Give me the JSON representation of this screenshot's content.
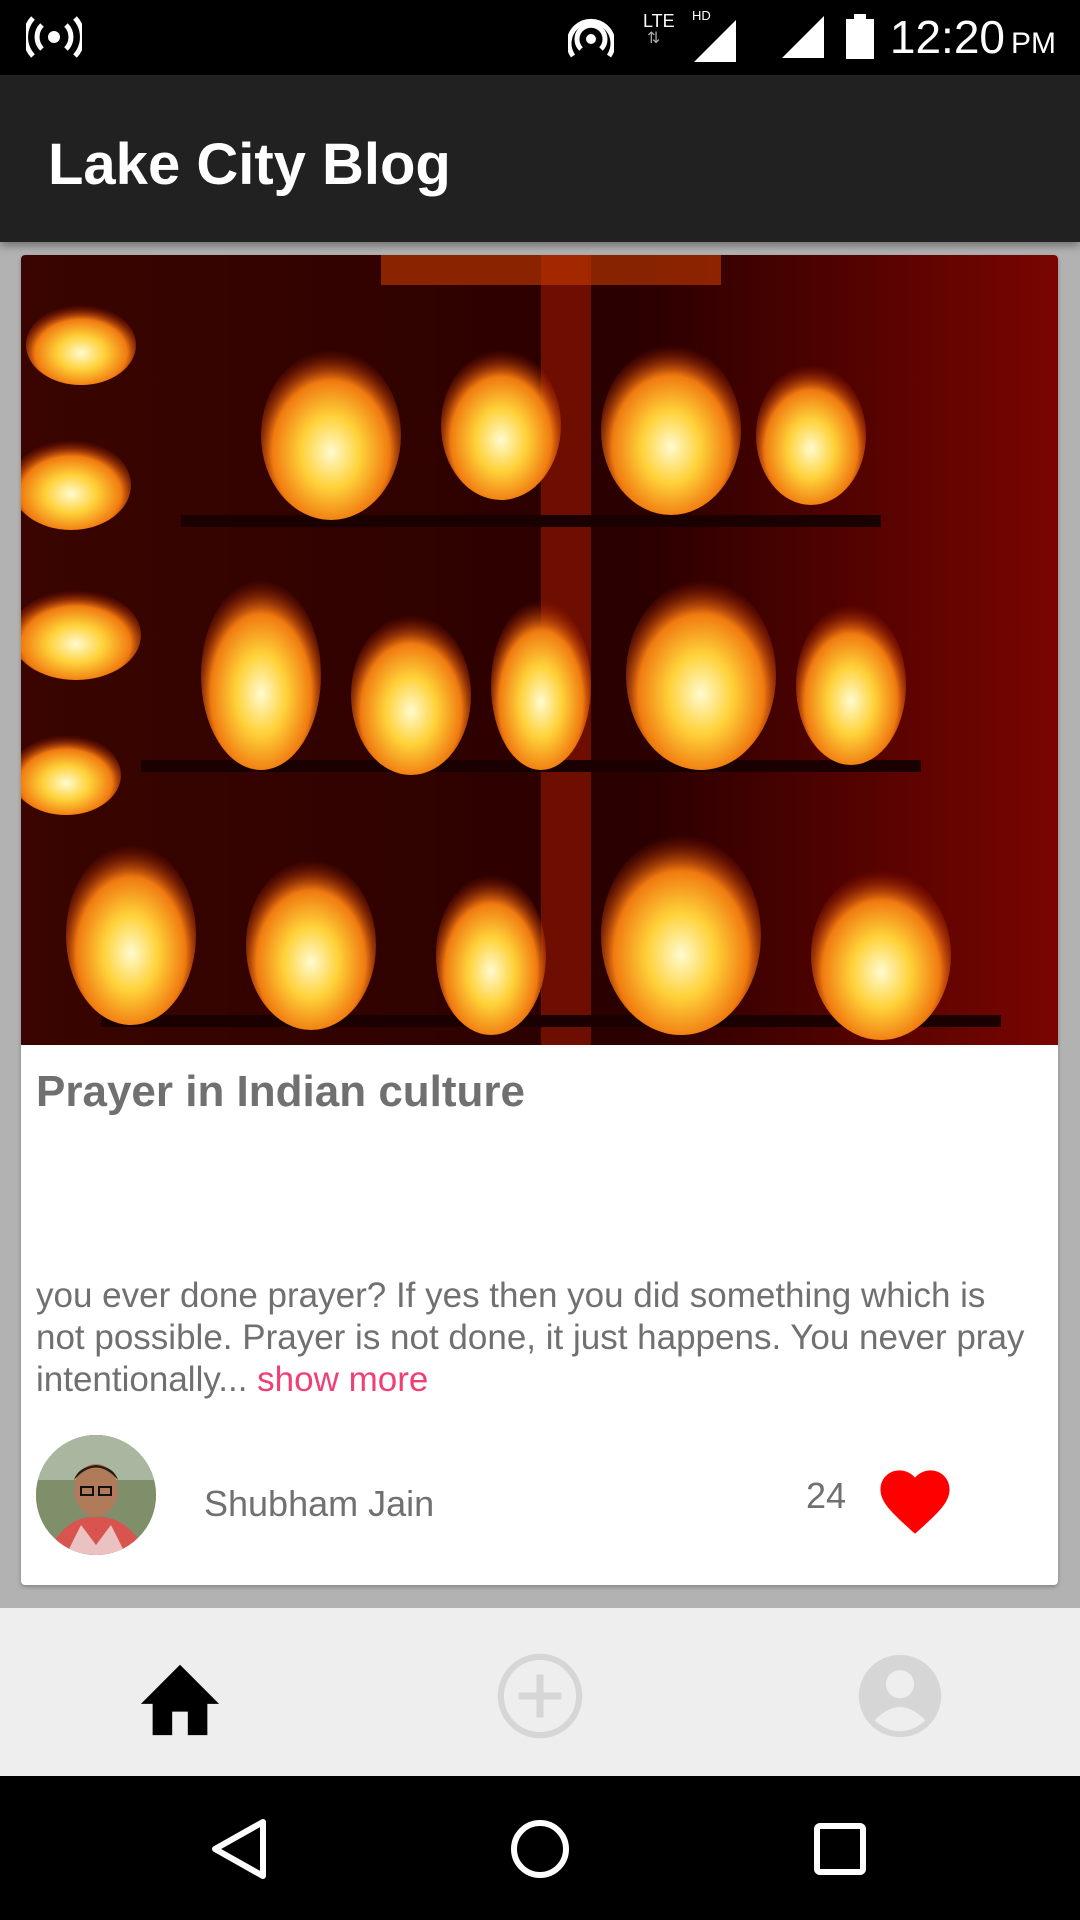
{
  "status_bar": {
    "time": "12:20",
    "ampm": "PM",
    "network_label": "LTE",
    "hd_label": "HD",
    "icons": [
      "hotspot-icon",
      "wifi-tethering-icon",
      "lte-data-icon",
      "signal-hd-icon",
      "signal-icon",
      "battery-icon"
    ]
  },
  "app_bar": {
    "title": "Lake City Blog"
  },
  "post": {
    "title": "Prayer in Indian culture",
    "excerpt": " you ever done prayer? If yes then you did something which is not possible. Prayer is not done, it just happens. You never pray intentionally...",
    "show_more_label": "show more",
    "author": "Shubham Jain",
    "likes": "24",
    "like_color": "#ff0000"
  },
  "bottom_nav": {
    "items": [
      {
        "name": "home",
        "icon": "home-icon",
        "active": true
      },
      {
        "name": "add-post",
        "icon": "add-circle-icon",
        "active": false
      },
      {
        "name": "profile",
        "icon": "account-circle-icon",
        "active": false
      }
    ]
  },
  "system_nav": {
    "items": [
      "back-icon",
      "home-circle-icon",
      "recents-icon"
    ]
  },
  "colors": {
    "app_bar": "#212121",
    "accent_link": "#ef3f74",
    "text_gray": "#707070"
  }
}
